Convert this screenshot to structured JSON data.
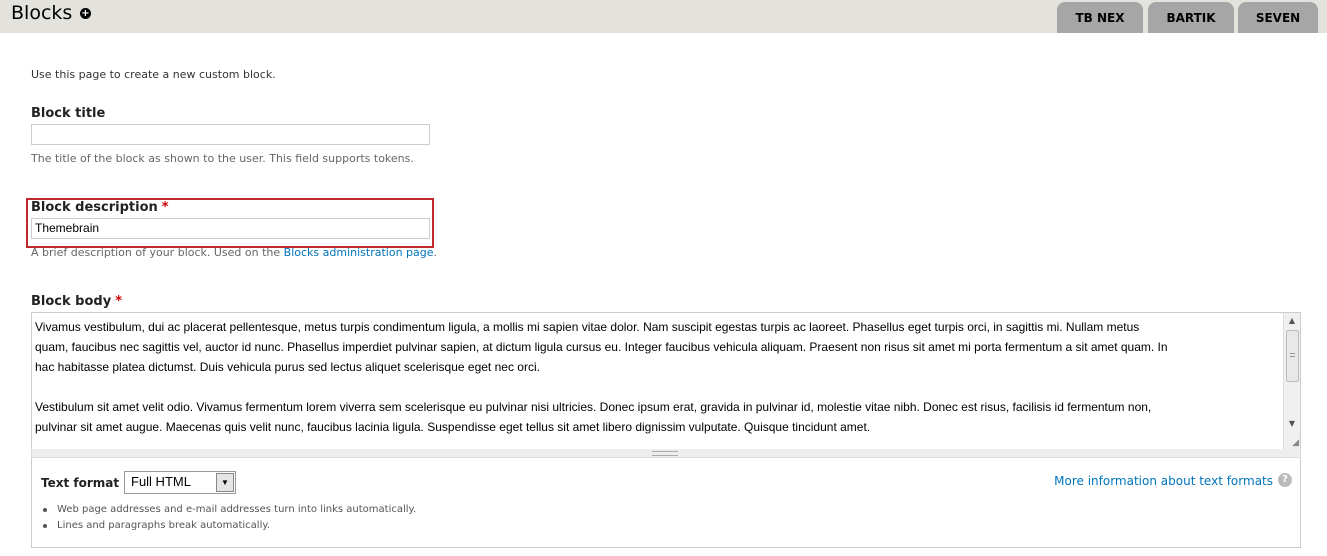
{
  "header": {
    "title": "Blocks",
    "add_icon": "plus-circle-icon",
    "tabs": [
      {
        "label": "TB NEX"
      },
      {
        "label": "BARTIK"
      },
      {
        "label": "SEVEN"
      }
    ]
  },
  "intro": "Use this page to create a new custom block.",
  "block_title": {
    "label": "Block title",
    "value": "",
    "description": "The title of the block as shown to the user. This field supports tokens."
  },
  "block_description": {
    "label": "Block description",
    "required_mark": "*",
    "value": "Themebrain",
    "description_prefix": "A brief description of your block. Used on the ",
    "description_link": "Blocks administration page",
    "description_suffix": "."
  },
  "block_body": {
    "label": "Block body",
    "required_mark": "*",
    "value": "Vivamus vestibulum, dui ac placerat pellentesque, metus turpis condimentum ligula, a mollis mi sapien vitae dolor. Nam suscipit egestas turpis ac laoreet. Phasellus eget turpis orci, in sagittis mi. Nullam metus\nquam, faucibus nec sagittis vel, auctor id nunc. Phasellus imperdiet pulvinar sapien, at dictum ligula cursus eu. Integer faucibus vehicula aliquam. Praesent non risus sit amet mi porta fermentum a sit amet quam. In\nhac habitasse platea dictumst. Duis vehicula purus sed lectus aliquet scelerisque eget nec orci.\n\nVestibulum sit amet velit odio. Vivamus fermentum lorem viverra sem scelerisque eu pulvinar nisi ultricies. Donec ipsum erat, gravida in pulvinar id, molestie vitae nibh. Donec est risus, facilisis id fermentum non,\npulvinar sit amet augue. Maecenas quis velit nunc, faucibus lacinia ligula. Suspendisse eget tellus sit amet libero dignissim vulputate. Quisque tincidunt amet."
  },
  "text_format": {
    "label": "Text format",
    "selected": "Full HTML",
    "more_info": "More information about text formats",
    "tips": [
      "Web page addresses and e-mail addresses turn into links automatically.",
      "Lines and paragraphs break automatically."
    ]
  },
  "colors": {
    "header_bg": "#e3e2dd",
    "tab_bg": "#a6a6a6",
    "highlight_border": "#c1272d",
    "link": "#0074bd",
    "required": "#cc0000"
  }
}
